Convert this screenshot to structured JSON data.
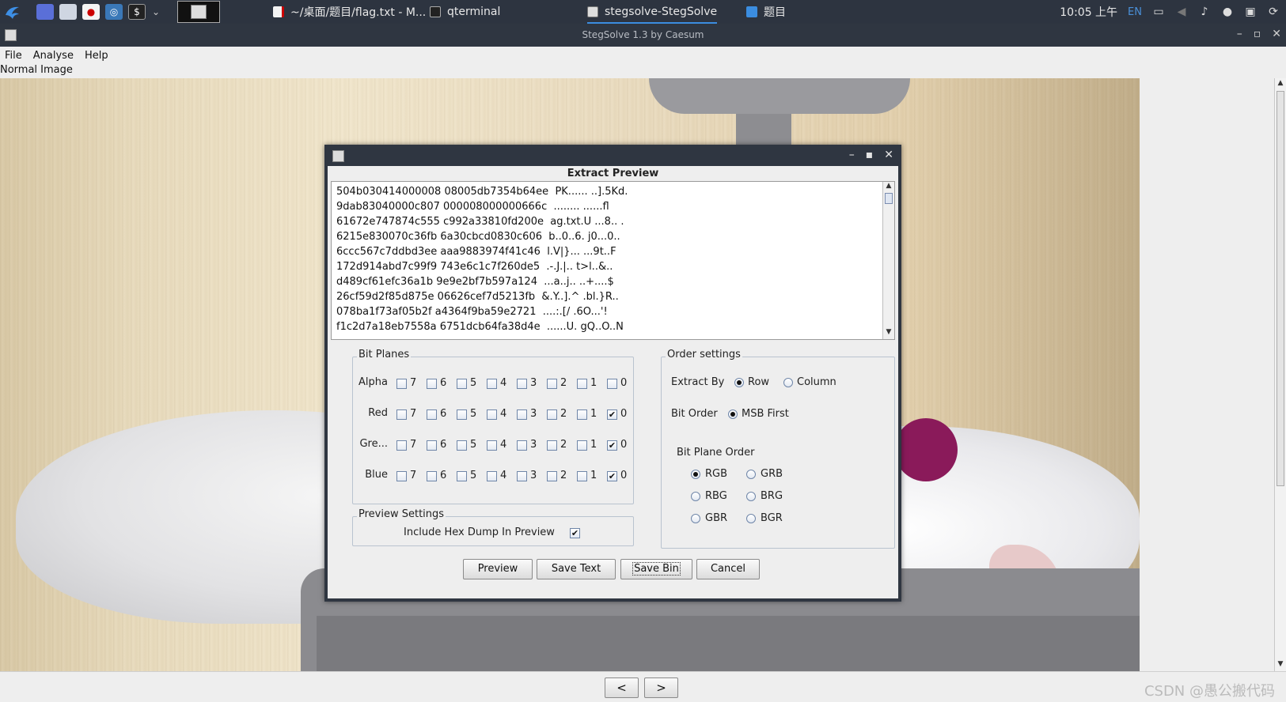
{
  "taskbar": {
    "tasks": [
      {
        "label": "~/桌面/题目/flag.txt - M...",
        "icon": "text-file-icon"
      },
      {
        "label": "qterminal",
        "icon": "terminal-icon"
      },
      {
        "label": "stegsolve-StegSolve",
        "icon": "java-app-icon"
      },
      {
        "label": "题目",
        "icon": "folder-icon"
      }
    ],
    "clock": "10:05 上午",
    "language": "EN"
  },
  "window": {
    "title": "StegSolve 1.3 by Caesum",
    "menu": [
      "File",
      "Analyse",
      "Help"
    ],
    "image_label": "Normal Image"
  },
  "navigation": {
    "prev_label": "<",
    "next_label": ">"
  },
  "watermark": "CSDN @愚公搬代码",
  "dialog": {
    "heading": "Extract Preview",
    "preview_lines": [
      "504b030414000008 08005db7354b64ee  PK...... ..].5Kd.",
      "9dab83040000c807 000008000000666c  ........ ......fl",
      "61672e747874c555 c992a33810fd200e  ag.txt.U ...8.. .",
      "6215e830070c36fb 6a30cbcd0830c606  b..0..6. j0...0..",
      "6ccc567c7ddbd3ee aaa9883974f41c46  l.V|}... ...9t..F",
      "172d914abd7c99f9 743e6c1c7f260de5  .-.J.|.. t>l..&..",
      "d489cf61efc36a1b 9e9e2bf7b597a124  ...a..j.. ..+....$",
      "26cf59d2f85d875e 06626cef7d5213fb  &.Y..].^ .bl.}R..",
      "078ba1f73af05b2f a4364f9ba59e2721  ....:.[/ .6O...'!",
      "f1c2d7a18eb7558a 6751dcb64fa38d4e  ......U. gQ..O..N"
    ],
    "bit_planes": {
      "label": "Bit Planes",
      "bits": [
        "7",
        "6",
        "5",
        "4",
        "3",
        "2",
        "1",
        "0"
      ],
      "rows": [
        {
          "label": "Alpha",
          "checked": [
            false,
            false,
            false,
            false,
            false,
            false,
            false,
            false
          ]
        },
        {
          "label": "Red",
          "checked": [
            false,
            false,
            false,
            false,
            false,
            false,
            false,
            true
          ]
        },
        {
          "label": "Gre...",
          "checked": [
            false,
            false,
            false,
            false,
            false,
            false,
            false,
            true
          ]
        },
        {
          "label": "Blue",
          "checked": [
            false,
            false,
            false,
            false,
            false,
            false,
            false,
            true
          ]
        }
      ]
    },
    "preview_settings": {
      "label": "Preview Settings",
      "hex_dump_label": "Include Hex Dump In Preview",
      "hex_dump_checked": true
    },
    "order_settings": {
      "label": "Order settings",
      "extract_by_label": "Extract By",
      "row_label": "Row",
      "column_label": "Column",
      "extract_by": "Row",
      "bit_order_label": "Bit Order",
      "msb_label": "MSB First",
      "bit_plane_order_label": "Bit Plane Order",
      "plane_orders": [
        "RGB",
        "GRB",
        "RBG",
        "BRG",
        "GBR",
        "BGR"
      ],
      "selected_plane_order": "RGB"
    },
    "buttons": {
      "preview": "Preview",
      "save_text": "Save Text",
      "save_bin": "Save Bin",
      "cancel": "Cancel"
    }
  }
}
